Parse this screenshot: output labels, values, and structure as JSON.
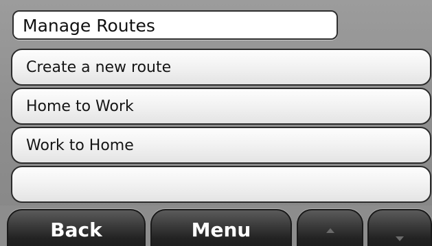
{
  "header": {
    "title": "Manage Routes"
  },
  "menu": {
    "items": [
      {
        "label": "Create a new route"
      },
      {
        "label": "Home to Work"
      },
      {
        "label": "Work to Home"
      },
      {
        "label": ""
      }
    ]
  },
  "toolbar": {
    "back_label": "Back",
    "menu_label": "Menu",
    "up_icon": "arrow-up-icon",
    "down_icon": "arrow-down-icon"
  },
  "colors": {
    "background": "#8d8d8d",
    "list_item": "#f3f3f3",
    "button": "#232323",
    "button_text": "#ffffff"
  }
}
